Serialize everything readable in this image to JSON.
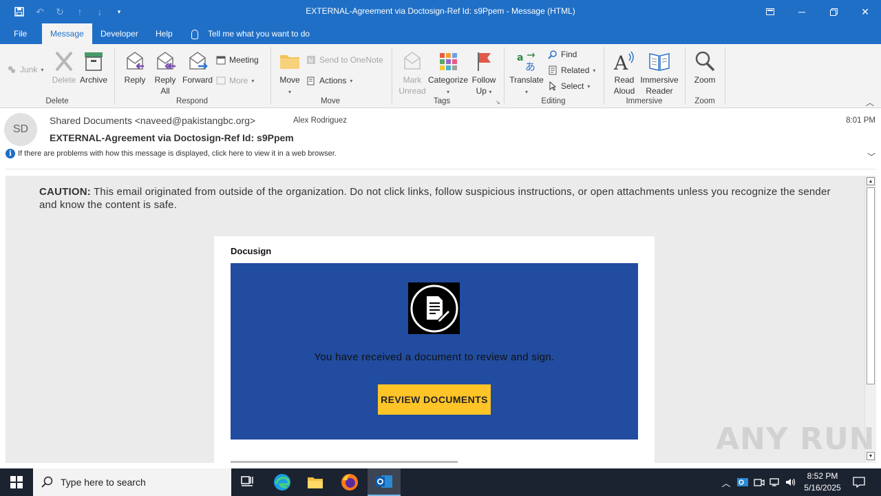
{
  "window": {
    "title": "EXTERNAL-Agreement via Doctosign-Ref Id: s9Ppem  -  Message (HTML)"
  },
  "menu": {
    "tabs": [
      "File",
      "Message",
      "Developer",
      "Help"
    ],
    "active_tab": "Message",
    "tell_me": "Tell me what you want to do"
  },
  "ribbon": {
    "groups": {
      "delete": "Delete",
      "respond": "Respond",
      "move": "Move",
      "tags": "Tags",
      "editing": "Editing",
      "immersive": "Immersive",
      "zoom": "Zoom"
    },
    "junk": "Junk",
    "delete": "Delete",
    "archive": "Archive",
    "reply": "Reply",
    "reply_all_1": "Reply",
    "reply_all_2": "All",
    "forward": "Forward",
    "meeting": "Meeting",
    "more": "More",
    "move": "Move",
    "send_to_onenote": "Send to OneNote",
    "actions": "Actions",
    "mark_unread_1": "Mark",
    "mark_unread_2": "Unread",
    "categorize": "Categorize",
    "follow_up_1": "Follow",
    "follow_up_2": "Up",
    "translate": "Translate",
    "find": "Find",
    "related": "Related",
    "select": "Select",
    "read_aloud_1": "Read",
    "read_aloud_2": "Aloud",
    "immersive_reader_1": "Immersive",
    "immersive_reader_2": "Reader",
    "zoom": "Zoom"
  },
  "message": {
    "avatar_initials": "SD",
    "sender": "Shared Documents <naveed@pakistangbc.org>",
    "recipient": "Alex Rodriguez",
    "subject": "EXTERNAL-Agreement via Doctosign-Ref Id: s9Ppem",
    "time": "8:01 PM",
    "info": "If there are problems with how this message is displayed, click here to view it in a web browser."
  },
  "email_body": {
    "caution_label": "CAUTION:",
    "caution_text": " This email originated from outside of the organization. Do not click links, follow suspicious instructions, or open attachments unless you recognize the sender and know the content is safe.",
    "brand": "Docusign",
    "banner_text": "You have received a document to review and sign.",
    "button": "REVIEW DOCUMENTS"
  },
  "watermark": "ANY RUN",
  "taskbar": {
    "search_placeholder": "Type here to search",
    "time": "8:52 PM",
    "date": "5/16/2025"
  },
  "colors": {
    "accent": "#1f6fc6",
    "banner": "#214c9f",
    "button": "#ffc428"
  }
}
